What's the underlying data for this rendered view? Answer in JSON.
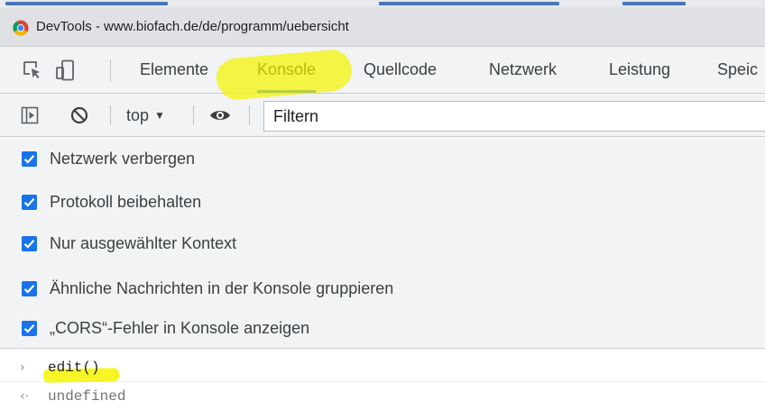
{
  "window": {
    "title": "DevTools - www.biofach.de/de/programm/uebersicht"
  },
  "main_tabs": [
    {
      "label": "Elemente",
      "active": false
    },
    {
      "label": "Konsole",
      "active": true
    },
    {
      "label": "Quellcode",
      "active": false
    },
    {
      "label": "Netzwerk",
      "active": false
    },
    {
      "label": "Leistung",
      "active": false
    },
    {
      "label": "Speic",
      "active": false
    }
  ],
  "toolbar": {
    "context_select": "top",
    "filter_placeholder": "Filtern"
  },
  "settings": {
    "options": [
      {
        "label": "Netzwerk verbergen",
        "checked": true
      },
      {
        "label": "Protokoll beibehalten",
        "checked": true
      },
      {
        "label": "Nur ausgewählter Kontext",
        "checked": true
      },
      {
        "label": "Ähnliche Nachrichten in der Konsole gruppieren",
        "checked": true
      },
      {
        "label": "„CORS“-Fehler in Konsole anzeigen",
        "checked": true
      }
    ]
  },
  "console": {
    "lines": [
      {
        "kind": "input",
        "prompt": "›",
        "text": "edit()"
      },
      {
        "kind": "output",
        "prompt": "‹·",
        "text": "undefined"
      }
    ]
  },
  "colors": {
    "accent": "#1a73e8",
    "highlighter": "#f4f400",
    "panel_bg": "#f1f3f4",
    "titlebar_bg": "#dfe1e5"
  },
  "icons": [
    "chrome-logo-icon",
    "inspect-element-icon",
    "device-toolbar-icon",
    "sidebar-toggle-icon",
    "clear-console-icon",
    "dropdown-arrow-icon",
    "live-expression-eye-icon",
    "checkmark-icon"
  ]
}
